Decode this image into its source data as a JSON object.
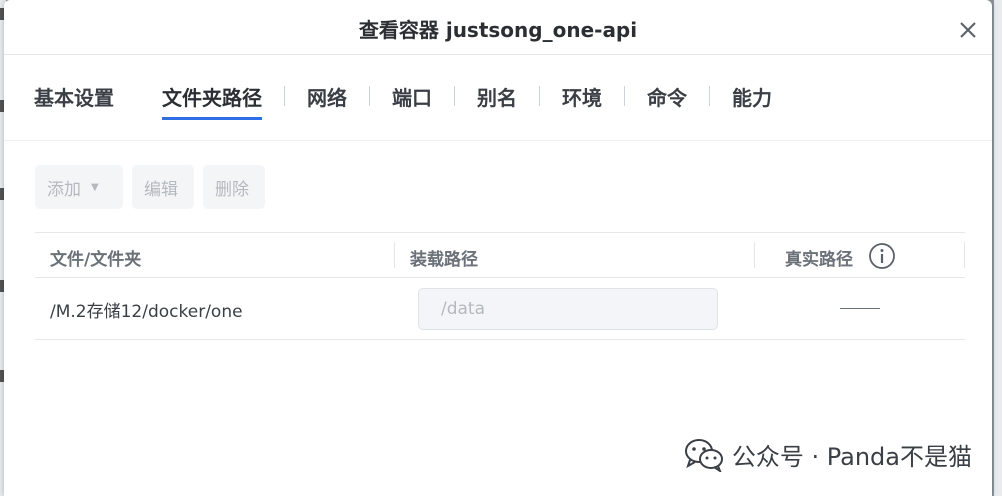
{
  "dialog": {
    "title": "查看容器 justsong_one-api"
  },
  "tabs": [
    {
      "label": "基本设置",
      "active": false
    },
    {
      "label": "文件夹路径",
      "active": true
    },
    {
      "label": "网络",
      "active": false
    },
    {
      "label": "端口",
      "active": false
    },
    {
      "label": "别名",
      "active": false
    },
    {
      "label": "环境",
      "active": false
    },
    {
      "label": "命令",
      "active": false
    },
    {
      "label": "能力",
      "active": false
    }
  ],
  "toolbar": {
    "add_label": "添加",
    "edit_label": "编辑",
    "delete_label": "删除"
  },
  "table": {
    "headers": {
      "host_path": "文件/文件夹",
      "mount_path": "装载路径",
      "real_path": "真实路径"
    },
    "rows": [
      {
        "host_path": "/M.2存储12/docker/one",
        "mount_path_placeholder": "/data",
        "real_path": "——"
      }
    ]
  },
  "watermark": {
    "text": "公众号 · Panda不是猫"
  },
  "colors": {
    "accent": "#2f6fe4",
    "text_primary": "#2b2f33",
    "text_disabled": "#b4b9bf"
  }
}
